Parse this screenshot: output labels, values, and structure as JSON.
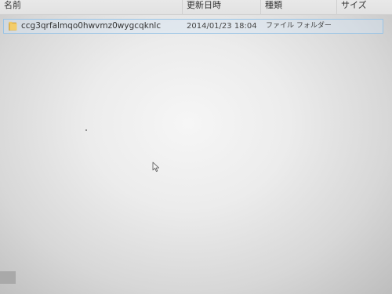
{
  "columns": {
    "name": "名前",
    "date_modified": "更新日時",
    "type": "種類",
    "size": "サイズ"
  },
  "files": [
    {
      "name": "ccg3qrfalmqo0hwvmz0wygcqknlc",
      "date_modified": "2014/01/23 18:04",
      "type": "ファイル フォルダー",
      "size": "",
      "icon": "folder-icon"
    }
  ],
  "colors": {
    "folder": "#e8b84a",
    "selection_border": "#99c4e6"
  }
}
